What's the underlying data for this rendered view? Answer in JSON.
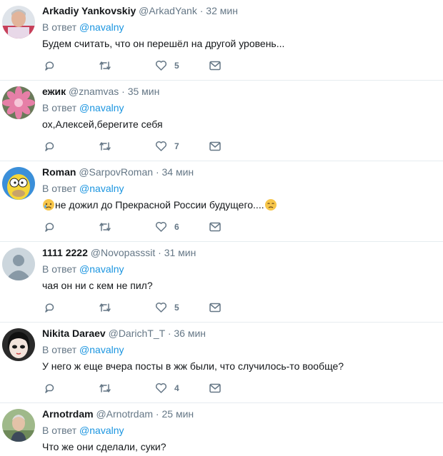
{
  "reply_prefix": "В ответ",
  "reply_to": "@navalny",
  "tweets": [
    {
      "name": "Arkadiy Yankovskiy",
      "handle": "@ArkadYank",
      "sep": "·",
      "time": "32 мин",
      "text": "Будем считать, что он перешёл на другой уровень...",
      "likes": "5",
      "avatar": "man-portrait-avatar"
    },
    {
      "name": "ежик",
      "handle": "@znamvas",
      "sep": "·",
      "time": "35 мин",
      "text": "ох,Алексей,берегите себя",
      "likes": "7",
      "avatar": "pink-flower-avatar"
    },
    {
      "name": "Roman",
      "handle": "@SarpovRoman",
      "sep": "·",
      "time": "34 мин",
      "text_before": "",
      "text": "не дожил до Прекрасной России будущего....",
      "likes": "6",
      "avatar": "cartoon-character-avatar",
      "emoji_start": "crying-face-emoji",
      "emoji_end": "sad-face-emoji"
    },
    {
      "name": "1111 2222",
      "handle": "@Novopasssit",
      "sep": "·",
      "time": "31 мин",
      "text": "чая он ни с кем не пил?",
      "likes": "5",
      "avatar": "default-egg-avatar"
    },
    {
      "name": "Nikita Daraev",
      "handle": "@DarichT_T",
      "sep": "·",
      "time": "36 мин",
      "text": "У него ж еще вчера посты в жж были, что случилось-то вообще?",
      "likes": "4",
      "avatar": "anime-face-avatar"
    },
    {
      "name": "Arnotrdam",
      "handle": "@Arnotrdam",
      "sep": "·",
      "time": "25 мин",
      "text": "Что же они сделали, суки?",
      "likes": "",
      "avatar": "older-man-avatar"
    }
  ],
  "colors": {
    "accent": "#1b95e0",
    "secondary": "#657786",
    "text": "#14171a",
    "border": "#e6ecf0"
  }
}
